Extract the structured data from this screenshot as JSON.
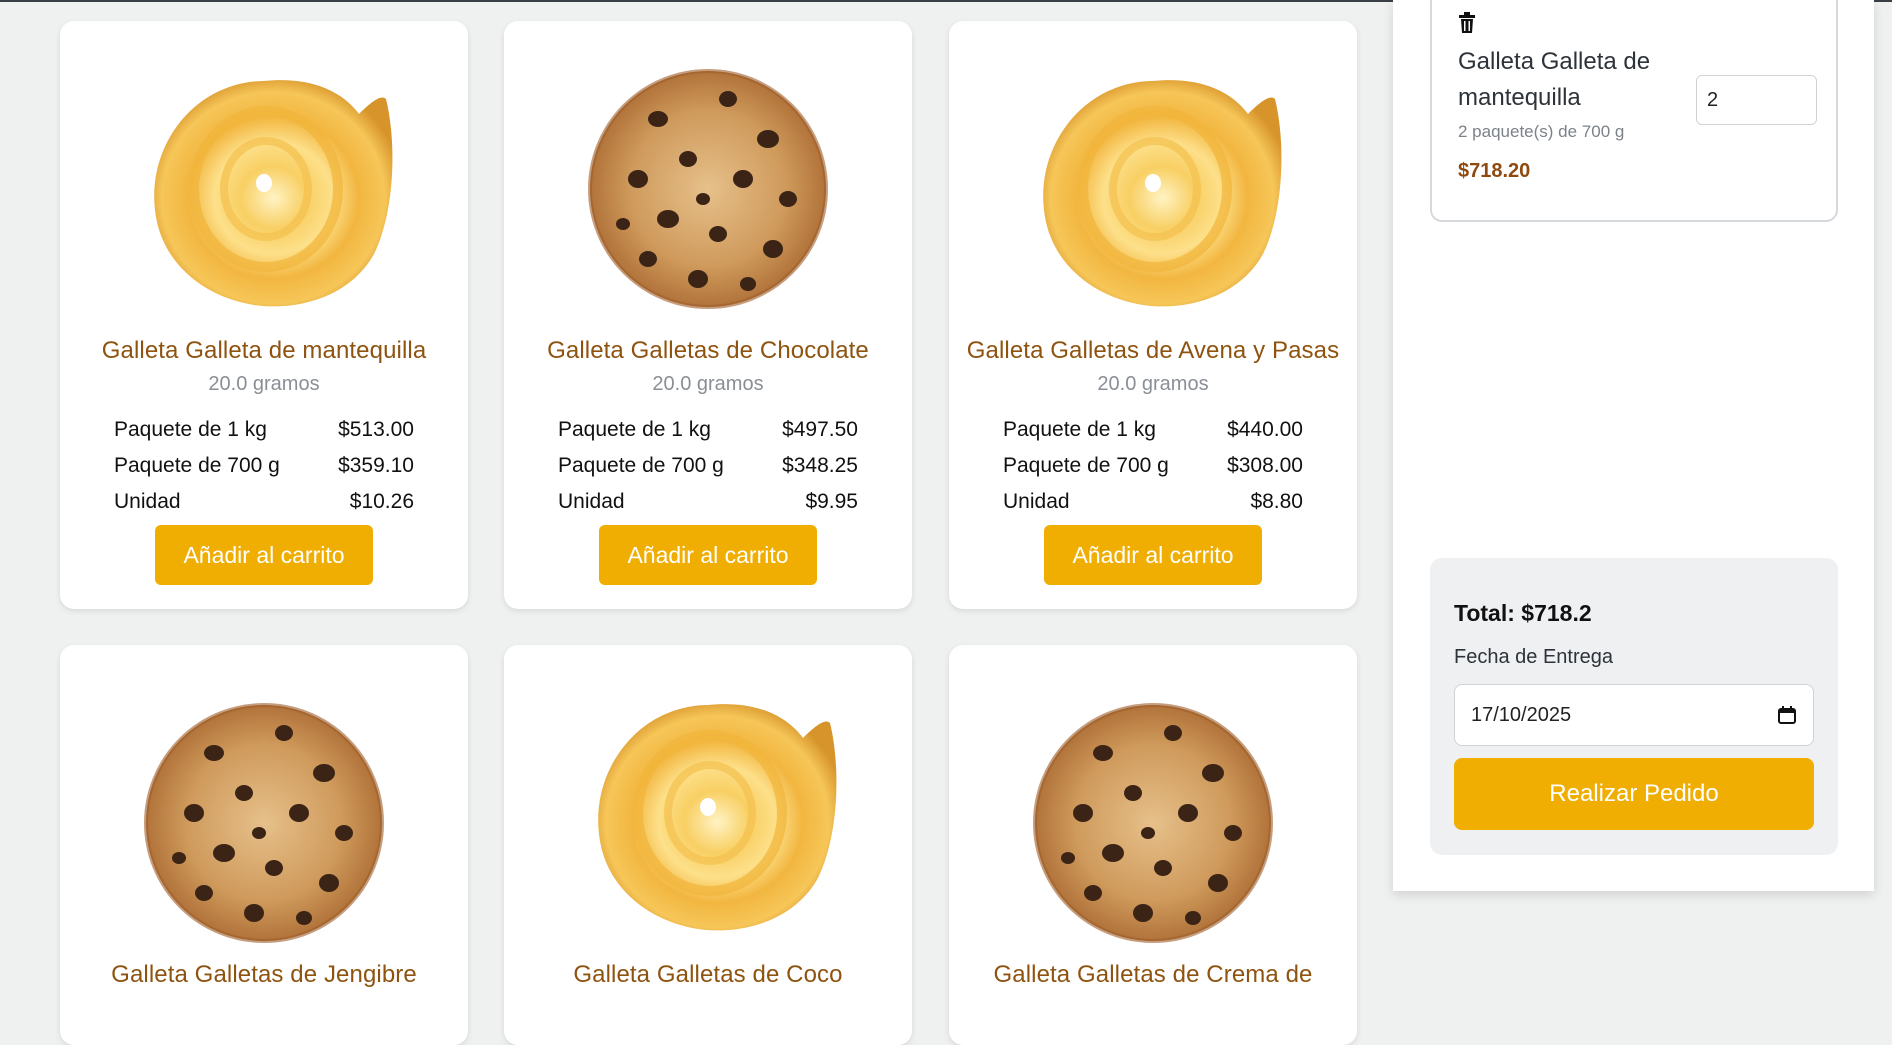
{
  "products": [
    {
      "title": "Galleta Galleta de mantequilla",
      "weight": "20.0 gramos",
      "image": "butter-cookie",
      "prices": [
        {
          "label": "Paquete de 1 kg",
          "price": "$513.00"
        },
        {
          "label": "Paquete de 700 g",
          "price": "$359.10"
        },
        {
          "label": "Unidad",
          "price": "$10.26"
        }
      ],
      "button": "Añadir al carrito"
    },
    {
      "title": "Galleta Galletas de Chocolate",
      "weight": "20.0 gramos",
      "image": "chocolate-chip-cookie",
      "prices": [
        {
          "label": "Paquete de 1 kg",
          "price": "$497.50"
        },
        {
          "label": "Paquete de 700 g",
          "price": "$348.25"
        },
        {
          "label": "Unidad",
          "price": "$9.95"
        }
      ],
      "button": "Añadir al carrito"
    },
    {
      "title": "Galleta Galletas de Avena y Pasas",
      "weight": "20.0 gramos",
      "image": "butter-cookie",
      "prices": [
        {
          "label": "Paquete de 1 kg",
          "price": "$440.00"
        },
        {
          "label": "Paquete de 700 g",
          "price": "$308.00"
        },
        {
          "label": "Unidad",
          "price": "$8.80"
        }
      ],
      "button": "Añadir al carrito"
    },
    {
      "title": "Galleta Galletas de Jengibre",
      "image": "chocolate-chip-cookie"
    },
    {
      "title": "Galleta Galletas de Coco",
      "image": "butter-cookie"
    },
    {
      "title": "Galleta Galletas de Crema de",
      "image": "chocolate-chip-cookie"
    }
  ],
  "cart": {
    "item": {
      "name": "Galleta Galleta de mantequilla",
      "detail": "2 paquete(s) de 700 g",
      "price": "$718.20",
      "quantity": "2"
    },
    "total": "Total: $718.2",
    "date_label": "Fecha de Entrega",
    "date_value": "17/10/2025",
    "order_button": "Realizar Pedido"
  },
  "colors": {
    "accent": "#f0ad02",
    "title_brown": "#8f5310",
    "background": "#eff0f0"
  }
}
